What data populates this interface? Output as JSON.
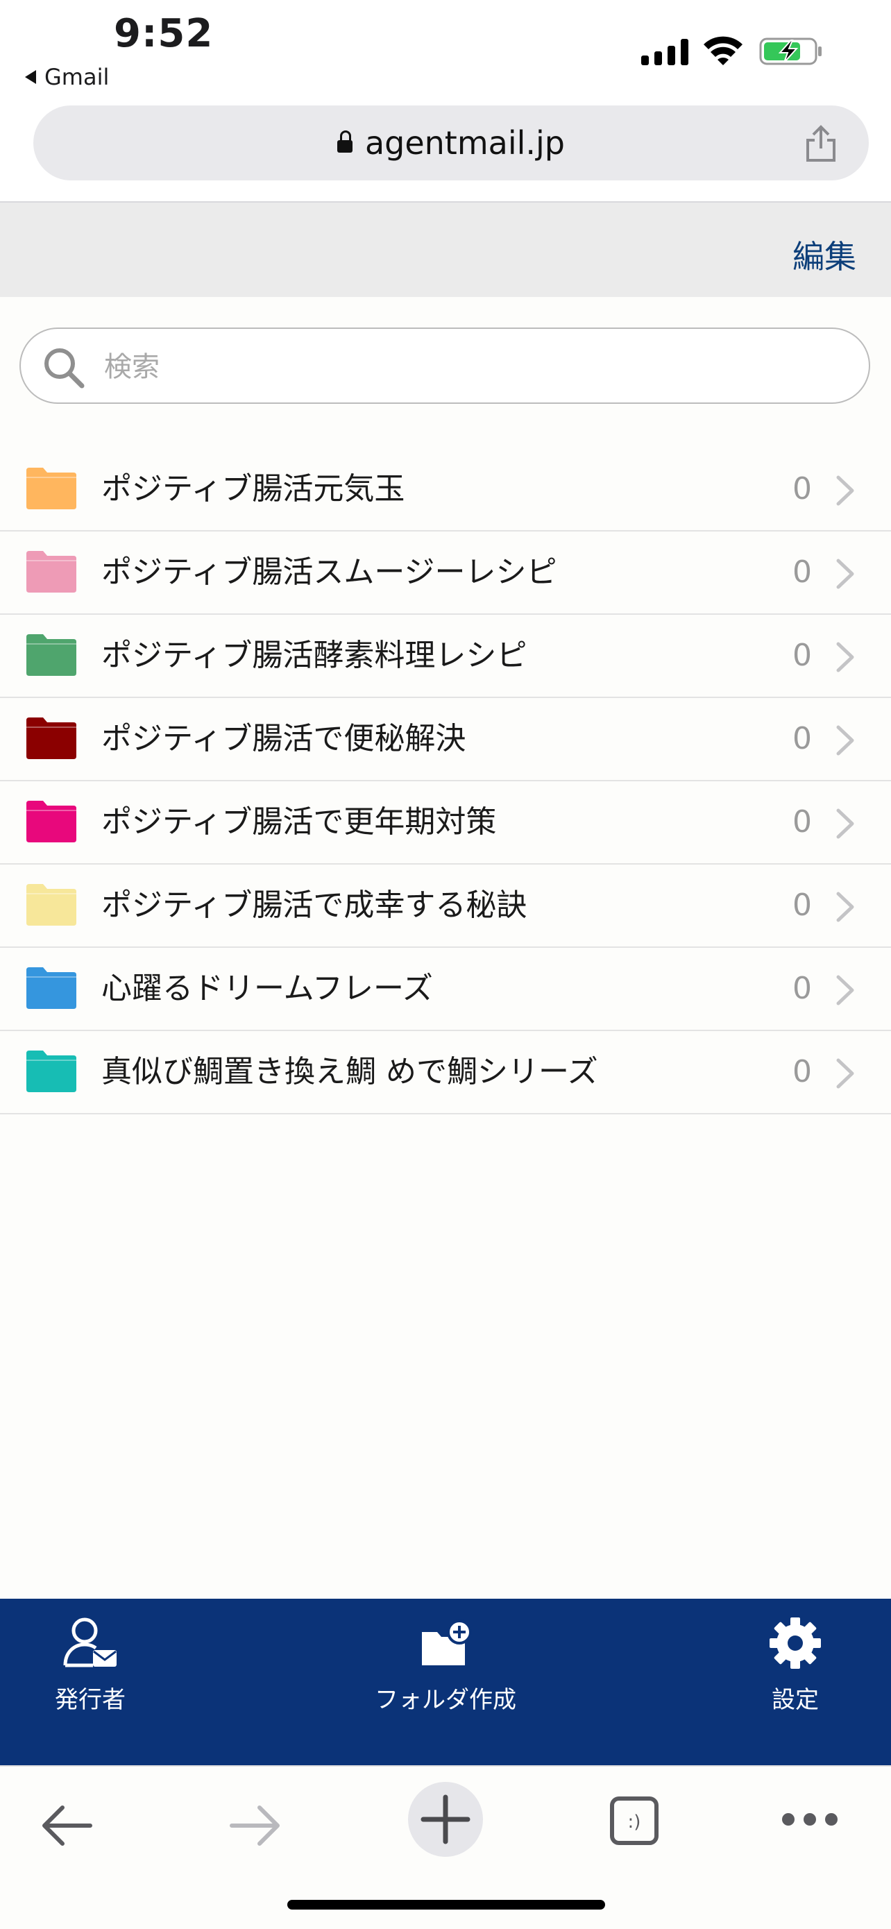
{
  "status_bar": {
    "time": "9:52",
    "back_app": "Gmail"
  },
  "browser": {
    "url": "agentmail.jp"
  },
  "header": {
    "edit_label": "編集"
  },
  "search": {
    "placeholder": "検索"
  },
  "folders": [
    {
      "name": "ポジティブ腸活元気玉",
      "count": "0",
      "color": "#ffb65e"
    },
    {
      "name": "ポジティブ腸活スムージーレシピ",
      "count": "0",
      "color": "#ee9bb6"
    },
    {
      "name": "ポジティブ腸活酵素料理レシピ",
      "count": "0",
      "color": "#4fa56d"
    },
    {
      "name": "ポジティブ腸活で便秘解決",
      "count": "0",
      "color": "#8b0000"
    },
    {
      "name": "ポジティブ腸活で更年期対策",
      "count": "0",
      "color": "#e8087c"
    },
    {
      "name": "ポジティブ腸活で成幸する秘訣",
      "count": "0",
      "color": "#f7e79a"
    },
    {
      "name": "心躍るドリームフレーズ",
      "count": "0",
      "color": "#3596de"
    },
    {
      "name": "真似び鯛置き換え鯛 めで鯛シリーズ",
      "count": "0",
      "color": "#17bdb4"
    }
  ],
  "toolbar": {
    "sender_label": "発行者",
    "create_folder_label": "フォルダ作成",
    "settings_label": "設定"
  },
  "colors": {
    "toolbar_bg": "#0b3378",
    "edit_text": "#0d3f7a"
  }
}
